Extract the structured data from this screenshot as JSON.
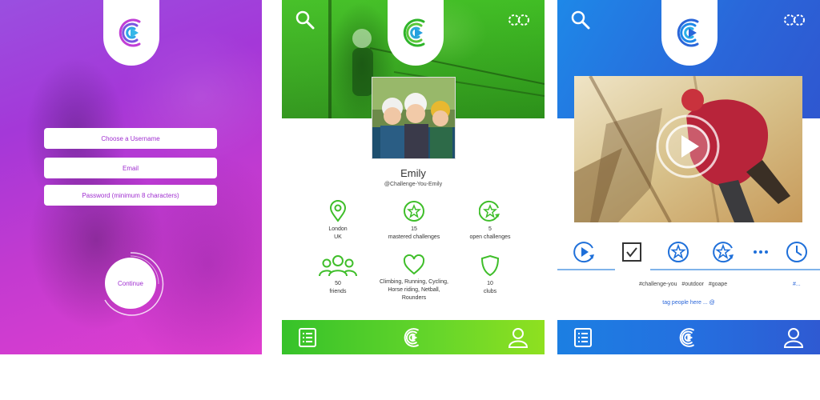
{
  "signup": {
    "username_placeholder": "Choose a Username",
    "email_placeholder": "Email",
    "password_placeholder": "Password (minimum 8 characters)",
    "continue_label": "Continue"
  },
  "profile": {
    "name": "Emily",
    "handle": "@Challenge-You-Emily",
    "stats": {
      "location": {
        "line1": "London",
        "line2": "UK"
      },
      "mastered": {
        "line1": "15",
        "line2": "mastered challenges"
      },
      "open": {
        "line1": "5",
        "line2": "open challenges"
      },
      "friends": {
        "line1": "50",
        "line2": "friends"
      },
      "interests": {
        "line1": "Climbing, Running, Cycling,",
        "line2": "Horse riding, Netball,",
        "line3": "Rounders"
      },
      "clubs": {
        "line1": "10",
        "line2": "clubs"
      }
    }
  },
  "video": {
    "tags": [
      "#challenge-you",
      "#outdoor",
      "#goape"
    ],
    "hash_symbol": "#...",
    "tag_people": "tag people here ... @"
  },
  "colors": {
    "purple": "#a438d8",
    "magenta": "#e23fcf",
    "green": "#38b81e",
    "lime": "#8fe020",
    "blue": "#1e88e8",
    "indigo": "#2f57d0"
  },
  "icons": [
    "search-icon",
    "settings-icon",
    "list-icon",
    "app-logo-icon",
    "profile-icon",
    "location-icon",
    "star-icon",
    "friends-icon",
    "heart-icon",
    "shield-icon",
    "play-icon",
    "checkbox-icon",
    "more-icon",
    "clock-icon"
  ]
}
